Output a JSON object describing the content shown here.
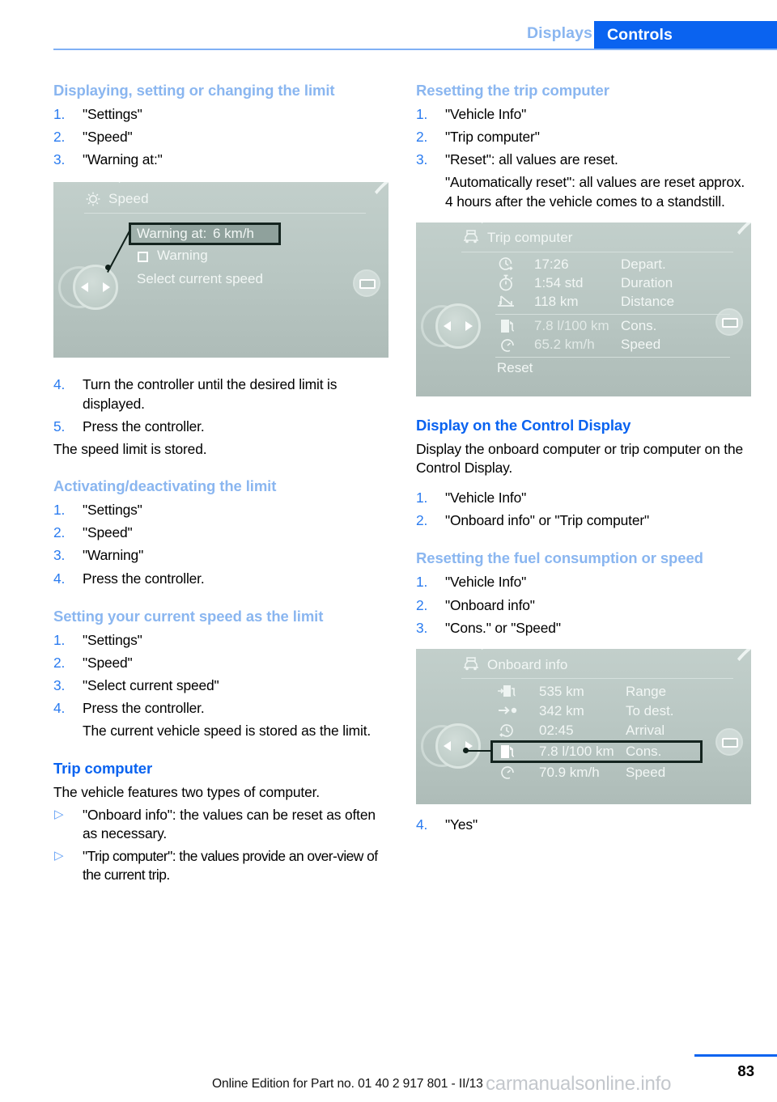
{
  "header": {
    "tab_inactive": "Displays",
    "tab_active": "Controls",
    "accent_blue": "#0a63f0",
    "light_blue": "#8ab6f0"
  },
  "left_column": {
    "section1": {
      "heading": "Displaying, setting or changing the limit",
      "steps": [
        {
          "num": "1.",
          "text": "\"Settings\""
        },
        {
          "num": "2.",
          "text": "\"Speed\""
        },
        {
          "num": "3.",
          "text": "\"Warning at:\""
        }
      ],
      "steps_after": [
        {
          "num": "4.",
          "text": "Turn the controller until the desired limit is displayed."
        },
        {
          "num": "5.",
          "text": "Press the controller."
        }
      ],
      "closing": "The speed limit is stored."
    },
    "section2": {
      "heading": "Activating/deactivating the limit",
      "steps": [
        {
          "num": "1.",
          "text": "\"Settings\""
        },
        {
          "num": "2.",
          "text": "\"Speed\""
        },
        {
          "num": "3.",
          "text": "\"Warning\""
        },
        {
          "num": "4.",
          "text": "Press the controller."
        }
      ]
    },
    "section3": {
      "heading": "Setting your current speed as the limit",
      "steps": [
        {
          "num": "1.",
          "text": "\"Settings\""
        },
        {
          "num": "2.",
          "text": "\"Speed\""
        },
        {
          "num": "3.",
          "text": "\"Select current speed\""
        },
        {
          "num": "4.",
          "text": "Press the controller."
        }
      ],
      "substep": "The current vehicle speed is stored as the limit."
    },
    "section4": {
      "heading": "Trip computer",
      "intro": "The vehicle features two types of computer.",
      "bullets": [
        {
          "marker": "▷",
          "text": "\"Onboard info\": the values can be reset as often as necessary."
        },
        {
          "marker": "▷",
          "text": "\"Trip computer\": the values provide an over-view of the current trip."
        }
      ]
    }
  },
  "right_column": {
    "section1": {
      "heading": "Resetting the trip computer",
      "steps": [
        {
          "num": "1.",
          "text": "\"Vehicle Info\""
        },
        {
          "num": "2.",
          "text": "\"Trip computer\""
        },
        {
          "num": "3.",
          "text": "\"Reset\": all values are reset."
        }
      ],
      "substep": "\"Automatically reset\": all values are reset approx. 4 hours after the vehicle comes to a standstill."
    },
    "section2": {
      "heading": "Display on the Control Display",
      "intro": "Display the onboard computer or trip computer on the Control Display.",
      "steps": [
        {
          "num": "1.",
          "text": "\"Vehicle Info\""
        },
        {
          "num": "2.",
          "text": "\"Onboard info\" or \"Trip computer\""
        }
      ]
    },
    "section3": {
      "heading": "Resetting the fuel consumption or speed",
      "steps": [
        {
          "num": "1.",
          "text": "\"Vehicle Info\""
        },
        {
          "num": "2.",
          "text": "\"Onboard info\""
        },
        {
          "num": "3.",
          "text": "\"Cons.\" or \"Speed\""
        }
      ],
      "final_step": {
        "num": "4.",
        "text": "\"Yes\""
      }
    }
  },
  "figures": {
    "speed": {
      "title": "Speed",
      "title_icon": "settings-gear-icon",
      "highlight_label": "Warning at:",
      "highlight_value": "6 km/h",
      "checkbox_label": "Warning",
      "option_label": "Select current speed",
      "controller_icon": "idrive-controller-icon",
      "display_icon": "control-display-icon"
    },
    "trip_computer": {
      "title": "Trip computer",
      "title_icon": "vehicle-info-icon",
      "rows": [
        {
          "icon": "departure-clock-icon",
          "value": "17:26",
          "label": "Depart."
        },
        {
          "icon": "stopwatch-icon",
          "value": "1:54 std",
          "label": "Duration"
        },
        {
          "icon": "distance-road-icon",
          "value": "118 km",
          "label": "Distance"
        },
        {
          "icon": "fuel-pump-icon",
          "value": "7.8 l/100 km",
          "label": "Cons."
        },
        {
          "icon": "speedometer-icon",
          "value": "65.2 km/h",
          "label": "Speed"
        }
      ],
      "reset_label": "Reset",
      "controller_icon": "idrive-controller-icon",
      "display_icon": "control-display-icon"
    },
    "onboard_info": {
      "title": "Onboard info",
      "title_icon": "vehicle-info-icon",
      "rows": [
        {
          "icon": "range-fuel-icon",
          "value": "535 km",
          "label": "Range"
        },
        {
          "icon": "to-destination-icon",
          "value": "342 km",
          "label": "To dest."
        },
        {
          "icon": "arrival-clock-icon",
          "value": "02:45",
          "label": "Arrival"
        },
        {
          "icon": "fuel-pump-icon",
          "value": "7.8 l/100 km",
          "label": "Cons."
        },
        {
          "icon": "speedometer-icon",
          "value": "70.9 km/h",
          "label": "Speed"
        }
      ],
      "selected_row_index": 3,
      "controller_icon": "idrive-controller-icon",
      "display_icon": "control-display-icon"
    }
  },
  "footer": {
    "edition_text": "Online Edition for Part no. 01 40 2 917 801 - II/13",
    "page_number": "83",
    "watermark": "carmanualsonline.info"
  }
}
